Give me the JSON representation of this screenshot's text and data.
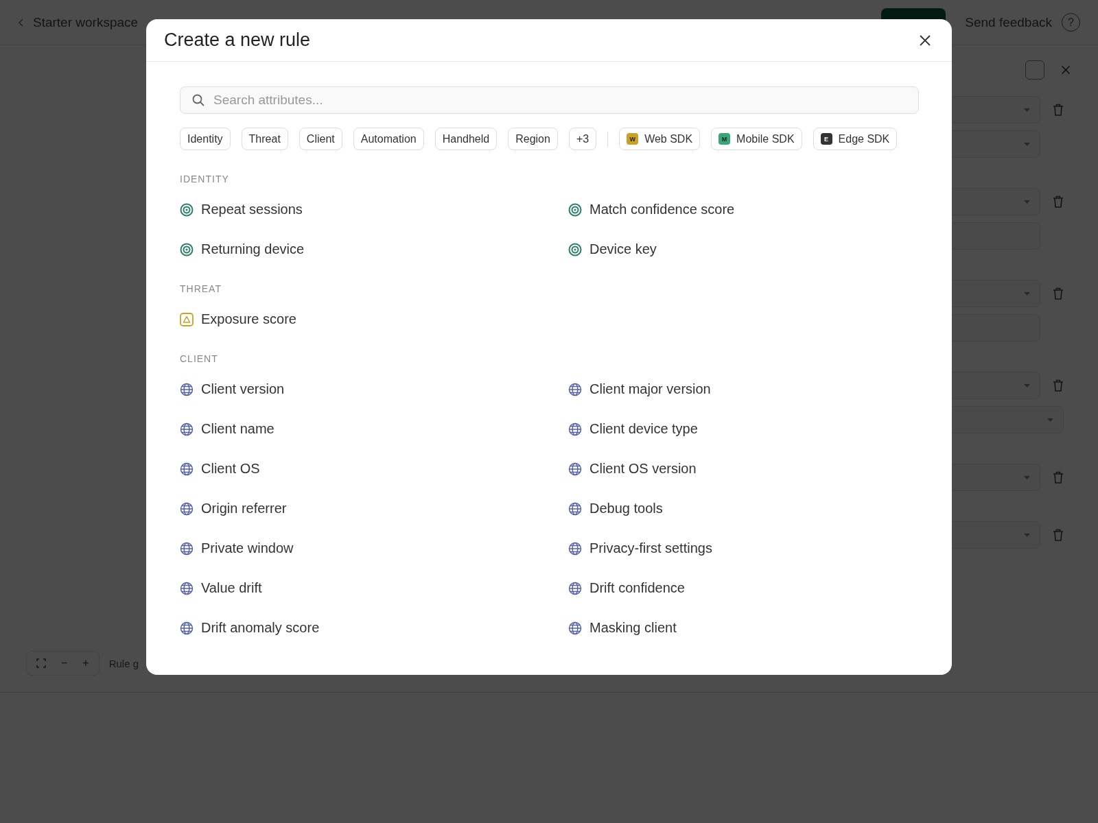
{
  "topbar": {
    "workspace": "Starter workspace",
    "feedback": "Send feedback",
    "help": "?"
  },
  "panel": {
    "groups": [
      {
        "rows": [
          {
            "kind": "select"
          },
          {
            "kind": "select"
          }
        ]
      },
      {
        "rows": [
          {
            "kind": "select"
          },
          {
            "kind": "input"
          }
        ]
      },
      {
        "rows": [
          {
            "kind": "select"
          },
          {
            "kind": "input"
          }
        ]
      },
      {
        "rows": [
          {
            "kind": "select"
          },
          {
            "kind": "wide"
          }
        ]
      },
      {
        "rows": [
          {
            "kind": "select"
          }
        ]
      },
      {
        "rows": [
          {
            "kind": "select"
          }
        ]
      }
    ]
  },
  "toolbar": {
    "minus": "−",
    "plus": "+",
    "label": "Rule g"
  },
  "modal": {
    "title": "Create a new rule",
    "search": {
      "placeholder": "Search attributes..."
    },
    "filters": [
      {
        "label": "Identity"
      },
      {
        "label": "Threat"
      },
      {
        "label": "Client"
      },
      {
        "label": "Automation"
      },
      {
        "label": "Handheld"
      },
      {
        "label": "Region"
      },
      {
        "label": "+3"
      }
    ],
    "sdks": [
      {
        "badge": "W",
        "label": "Web SDK",
        "color": "#c9a227"
      },
      {
        "badge": "M",
        "label": "Mobile SDK",
        "color": "#3aa57a"
      },
      {
        "badge": "E",
        "label": "Edge SDK",
        "color": "#333333"
      }
    ],
    "sections": [
      {
        "heading": "IDENTITY",
        "kind": "target",
        "items": [
          "Repeat sessions",
          "Match confidence score",
          "Returning device",
          "Device key"
        ]
      },
      {
        "heading": "THREAT",
        "kind": "warning",
        "items": [
          "Exposure score"
        ]
      },
      {
        "heading": "CLIENT",
        "kind": "globe",
        "items": [
          "Client version",
          "Client major version",
          "Client name",
          "Client device type",
          "Client OS",
          "Client OS version",
          "Origin referrer",
          "Debug tools",
          "Private window",
          "Privacy-first settings",
          "Value drift",
          "Drift confidence",
          "Drift anomaly score",
          "Masking client"
        ]
      }
    ]
  }
}
